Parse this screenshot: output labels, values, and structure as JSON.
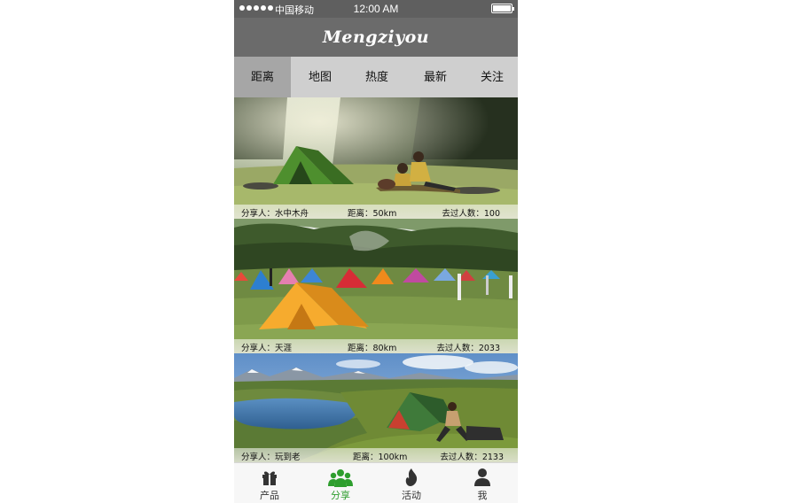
{
  "status_bar": {
    "carrier": "中国移动",
    "time": "12:00 AM"
  },
  "header": {
    "title": "Mengziyou"
  },
  "tabs": [
    {
      "label": "距离",
      "active": true
    },
    {
      "label": "地图",
      "active": false
    },
    {
      "label": "热度",
      "active": false
    },
    {
      "label": "最新",
      "active": false
    },
    {
      "label": "关注",
      "active": false
    }
  ],
  "feed": [
    {
      "sharer": "分享人：水中木舟",
      "distance": "距离：50km",
      "visitors": "去过人数：100",
      "image": "forest-clearing-green-tent"
    },
    {
      "sharer": "分享人：天涯",
      "distance": "距离：80km",
      "visitors": "去过人数：2033",
      "image": "crowded-campsite-orange-tent"
    },
    {
      "sharer": "分享人：玩到老",
      "distance": "距离：100km",
      "visitors": "去过人数：2133",
      "image": "lakeside-mountain-green-tent"
    }
  ],
  "bottom_tabs": [
    {
      "label": "产品",
      "icon": "gift-icon",
      "active": false
    },
    {
      "label": "分享",
      "icon": "group-icon",
      "active": true
    },
    {
      "label": "活动",
      "icon": "flame-icon",
      "active": false
    },
    {
      "label": "我",
      "icon": "user-icon",
      "active": false
    }
  ],
  "colors": {
    "status_bar": "#5f5f5f",
    "nav_bar": "#6b6b6b",
    "tabs_bg": "#cfcfcf",
    "tab_active": "#a6a6a6",
    "bottom_active": "#2e9e2e"
  }
}
